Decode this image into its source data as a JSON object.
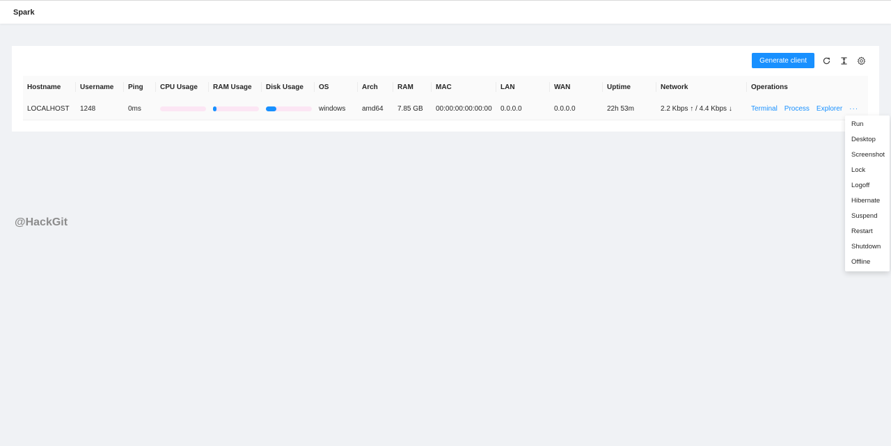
{
  "header": {
    "title": "Spark"
  },
  "toolbar": {
    "generate_label": "Generate client",
    "icons": [
      "reload-icon",
      "column-height-icon",
      "setting-icon"
    ]
  },
  "table": {
    "columns": [
      "Hostname",
      "Username",
      "Ping",
      "CPU Usage",
      "RAM Usage",
      "Disk Usage",
      "OS",
      "Arch",
      "RAM",
      "MAC",
      "LAN",
      "WAN",
      "Uptime",
      "Network",
      "Operations"
    ],
    "rows": [
      {
        "hostname": "LOCALHOST",
        "username": "1248",
        "ping": "0ms",
        "cpu_usage": 0,
        "ram_usage": 5,
        "disk_usage": 22,
        "os": "windows",
        "arch": "amd64",
        "ram": "7.85 GB",
        "mac": "00:00:00:00:00:00",
        "lan": "0.0.0.0",
        "wan": "0.0.0.0",
        "uptime": "22h 53m",
        "network": "2.2 Kbps ↑ / 4.4 Kbps ↓",
        "operations": [
          "Terminal",
          "Process",
          "Explorer"
        ],
        "more": "···"
      }
    ]
  },
  "dropdown": {
    "items": [
      "Run",
      "Desktop",
      "Screenshot",
      "Lock",
      "Logoff",
      "Hibernate",
      "Suspend",
      "Restart",
      "Shutdown",
      "Offline"
    ]
  },
  "watermark": "@HackGit",
  "colors": {
    "primary": "#1890ff",
    "bar_track": "#fce6f4",
    "background": "#f0f2f5"
  }
}
